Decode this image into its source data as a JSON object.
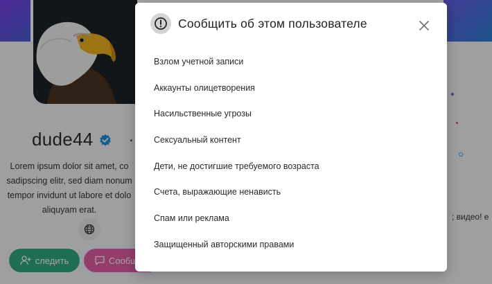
{
  "profile": {
    "username": "dude44",
    "bio_lines": "Lorem ipsum dolor sit amet, co\nsadipscing elitr, sed diam nonum\ntempor invidunt ut labore et dolo\naliquyam erat.",
    "follow_label": "следить",
    "report_label": "Сообщ"
  },
  "background": {
    "right_text": "; видео! е"
  },
  "modal": {
    "title": "Сообщить об этом пользователе",
    "reasons": [
      "Взлом учетной записи",
      "Аккаунты олицетворения",
      "Насильственные угрозы",
      "Сексуальный контент",
      "Дети, не достигшие требуемого возраста",
      "Счета, выражающие ненависть",
      "Спам или реклама",
      "Защищенный авторскими правами"
    ]
  },
  "colors": {
    "follow": "#2fa882",
    "report": "#e35fa8",
    "verified": "#1d8fe0"
  }
}
